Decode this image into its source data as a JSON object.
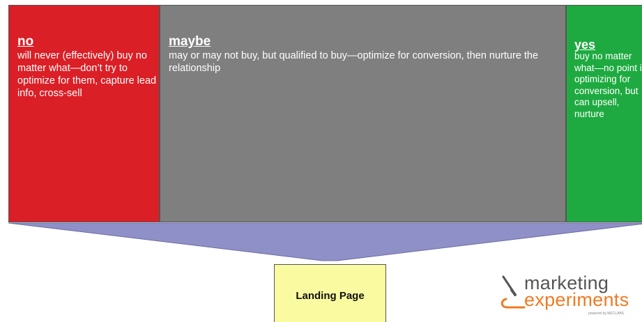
{
  "segments": [
    {
      "key": "no",
      "title": "no",
      "body": "will never (effectively) buy no matter what—don’t try to optimize for them, capture lead info, cross-sell",
      "color": "#da1f26"
    },
    {
      "key": "maybe",
      "title": "maybe",
      "body": "may or may not buy, but qualified to buy—optimize for conversion, then nurture the relationship",
      "color": "#7f7f7f"
    },
    {
      "key": "yes",
      "title": "yes",
      "body": "buy no matter what—no point in optimizing for conversion, but can upsell, nurture",
      "color": "#1eaa40"
    }
  ],
  "funnel": {
    "color": "#8f90c8"
  },
  "target": {
    "label": "Landing Page",
    "color": "#fafaa0"
  },
  "logo": {
    "line1": "marketing",
    "line2": "experiments",
    "tagline": "powered by MECLABS",
    "accent": "#f07a22"
  }
}
